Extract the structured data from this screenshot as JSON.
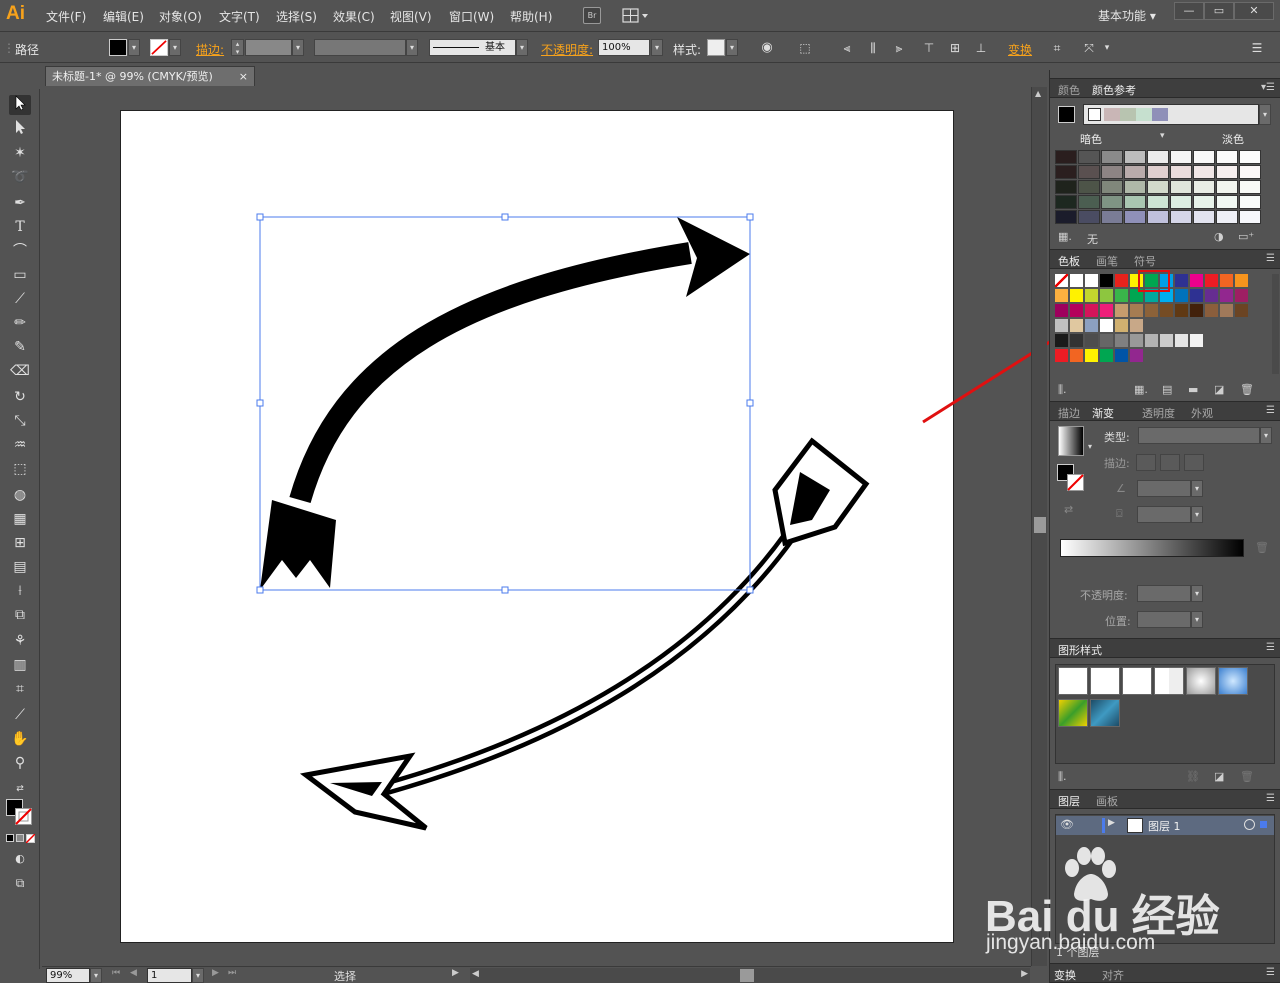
{
  "app": {
    "logo": "Ai",
    "menus": [
      "文件(F)",
      "编辑(E)",
      "对象(O)",
      "文字(T)",
      "选择(S)",
      "效果(C)",
      "视图(V)",
      "窗口(W)",
      "帮助(H)"
    ],
    "bridge_label": "Br",
    "workspace": "基本功能 ▾",
    "window_buttons": [
      "—",
      "▭",
      "✕"
    ]
  },
  "control_bar": {
    "object_type": "路径",
    "stroke_label": "描边:",
    "stroke_style": "基本",
    "opacity_label": "不透明度:",
    "opacity_value": "100%",
    "style_label": "样式:",
    "transform_label": "变换"
  },
  "document": {
    "tab_title": "未标题-1* @ 99% (CMYK/预览)",
    "close": "×"
  },
  "status_bar": {
    "zoom": "99%",
    "page": "1",
    "tool_status": "选择"
  },
  "panels": {
    "color": {
      "tabs": [
        "颜色",
        "颜色参考"
      ],
      "dark_label": "暗色",
      "light_label": "淡色",
      "none_label": "无",
      "harmony_colors": [
        "#c9b6b6",
        "#b8c4b0",
        "#c6e0cf",
        "#8f90b8"
      ],
      "grid_colors": [
        [
          "#2a1e1e",
          "#555555",
          "#8a8a8a",
          "#bdbdbd",
          "#ececec",
          "#f5f5f5",
          "#f8f8f8",
          "#fafafa",
          "#fcfcfc"
        ],
        [
          "#2b1f1f",
          "#5a5050",
          "#8d8484",
          "#b9abab",
          "#dfcfcf",
          "#eadcdc",
          "#f0e6e6",
          "#f6efef",
          "#fbf7f7"
        ],
        [
          "#1f231c",
          "#4d5448",
          "#80877b",
          "#afb8a8",
          "#d2dacb",
          "#e0e6db",
          "#e9ede5",
          "#f2f5ef",
          "#f8faf6"
        ],
        [
          "#1d2820",
          "#4b5e51",
          "#7f9484",
          "#a9c6b1",
          "#cde4d4",
          "#dceee2",
          "#e7f3ea",
          "#f1f8f3",
          "#f8fbf9"
        ],
        [
          "#1b1c2b",
          "#4a4c62",
          "#7a7c96",
          "#8f90b8",
          "#c0c1dc",
          "#d5d6e8",
          "#e2e3ef",
          "#eeeff6",
          "#f6f7fb"
        ]
      ]
    },
    "swatches": {
      "tabs": [
        "色板",
        "画笔",
        "符号"
      ],
      "rows": [
        [
          "#ffffff",
          "#ffffff",
          "#ffffff",
          "#000000",
          "#e8221c",
          "#fff200",
          "#00a650",
          "#00a0e6",
          "#2e3192",
          "#ec008c",
          "#ed1c24",
          "#f26522",
          "#f7941d"
        ],
        [
          "#fcb040",
          "#fff200",
          "#c3d62e",
          "#8dc63f",
          "#39b54a",
          "#00a651",
          "#00a99d",
          "#00aeef",
          "#0072bc",
          "#2e3192",
          "#662d91",
          "#92278f",
          "#9e1f63"
        ],
        [
          "#9e005d",
          "#b5005b",
          "#d4145a",
          "#ed1e79",
          "#c69c6d",
          "#a67c52",
          "#8c6239",
          "#754c24",
          "#603913",
          "#42210b",
          "#8b5e3c",
          "#a0795a",
          "#6b4423"
        ],
        [
          "#c0c0c0",
          "#e0c8a0",
          "#8ca0c0",
          "#ffffff",
          "#d0b070",
          "#c8a888"
        ],
        [
          "#1a1a1a",
          "#333333",
          "#4d4d4d",
          "#666666",
          "#808080",
          "#999999",
          "#b3b3b3",
          "#cccccc",
          "#e6e6e6",
          "#f2f2f2"
        ],
        [
          "#ed1c24",
          "#f26522",
          "#fff200",
          "#00a651",
          "#0054a6",
          "#92278f"
        ]
      ]
    },
    "gradient": {
      "tabs": [
        "描边",
        "渐变",
        "透明度",
        "外观"
      ],
      "type_label": "类型:",
      "stroke_label": "描边:",
      "opacity_label": "不透明度:",
      "position_label": "位置:"
    },
    "graphic_styles": {
      "tabs": [
        "图形样式"
      ]
    },
    "layers": {
      "tabs": [
        "图层",
        "画板"
      ],
      "layer_name": "图层 1",
      "count_label": "1 个图层"
    },
    "bottom": {
      "tabs": [
        "变换",
        "对齐"
      ]
    }
  },
  "watermark": {
    "brand": "Bai  du 经验",
    "url": "jingyan.baidu.com"
  }
}
